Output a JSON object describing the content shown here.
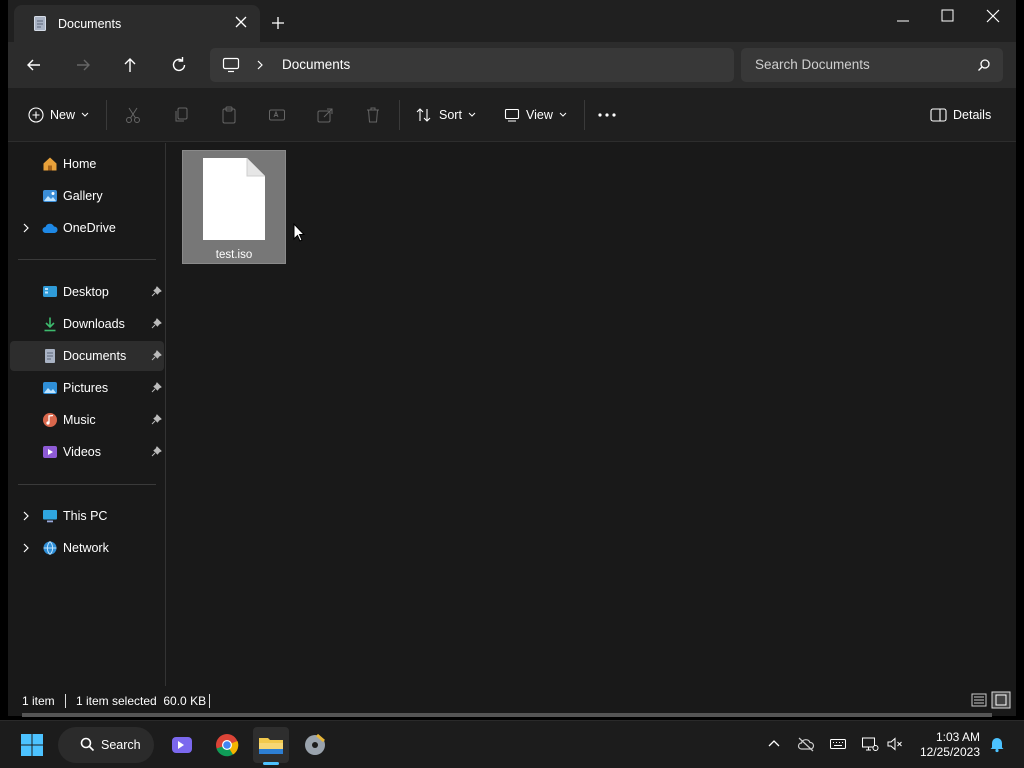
{
  "window": {
    "tab_title": "Documents"
  },
  "address": {
    "segments": [
      "Documents"
    ]
  },
  "search": {
    "placeholder": "Search Documents"
  },
  "commandbar": {
    "new_label": "New",
    "sort_label": "Sort",
    "view_label": "View",
    "details_label": "Details"
  },
  "sidebar": {
    "items": [
      {
        "label": "Home",
        "icon": "home-icon"
      },
      {
        "label": "Gallery",
        "icon": "gallery-icon"
      },
      {
        "label": "OneDrive",
        "icon": "cloud-icon"
      },
      {
        "label": "Desktop",
        "icon": "desktop-icon",
        "pinned": true
      },
      {
        "label": "Downloads",
        "icon": "download-icon",
        "pinned": true
      },
      {
        "label": "Documents",
        "icon": "documents-icon",
        "pinned": true,
        "selected": true
      },
      {
        "label": "Pictures",
        "icon": "pictures-icon",
        "pinned": true
      },
      {
        "label": "Music",
        "icon": "music-icon",
        "pinned": true
      },
      {
        "label": "Videos",
        "icon": "videos-icon",
        "pinned": true
      },
      {
        "label": "This PC",
        "icon": "pc-icon"
      },
      {
        "label": "Network",
        "icon": "network-icon"
      }
    ]
  },
  "files": [
    {
      "name": "test.iso",
      "selected": true
    }
  ],
  "status": {
    "item_count": "1 item",
    "selection": "1 item selected  60.0 KB"
  },
  "taskbar": {
    "search_label": "Search",
    "time": "1:03 AM",
    "date": "12/25/2023"
  },
  "colors": {
    "accent": "#4cc2ff",
    "window_bg": "#191919",
    "selected_tile": "#777777"
  }
}
